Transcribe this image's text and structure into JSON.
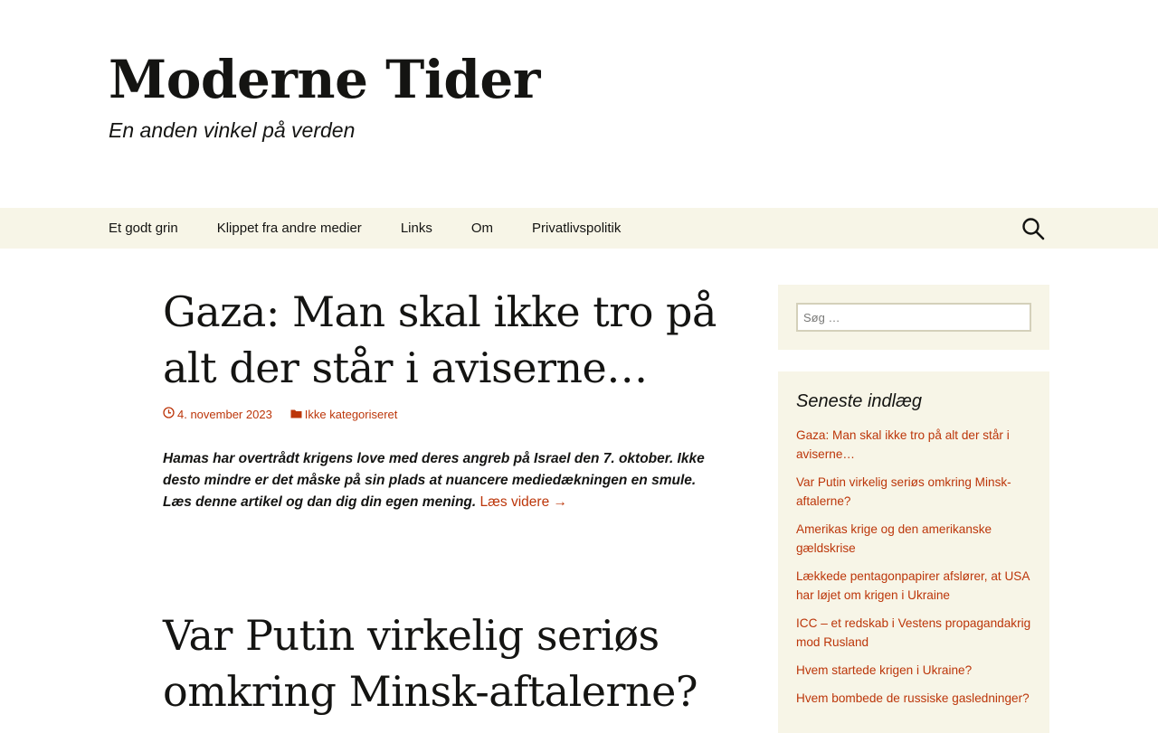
{
  "header": {
    "site_title": "Moderne Tider",
    "tagline": "En anden vinkel på verden"
  },
  "nav": {
    "items": [
      {
        "label": "Et godt grin"
      },
      {
        "label": "Klippet fra andre medier"
      },
      {
        "label": "Links"
      },
      {
        "label": "Om"
      },
      {
        "label": "Privatlivspolitik"
      }
    ],
    "search_icon": "search-icon"
  },
  "posts": [
    {
      "title": "Gaza: Man skal ikke tro på alt der står i aviserne…",
      "date": "4. november 2023",
      "category": "Ikke kategoriseret",
      "excerpt": "Hamas har overtrådt krigens love med deres angreb på Israel den 7. oktober. Ikke desto mindre er det måske på sin plads at nuancere mediedækningen en smule. Læs denne artikel og dan dig din egen mening.",
      "more": "Læs videre →"
    },
    {
      "title": "Var Putin virkelig seriøs omkring Minsk-aftalerne?"
    }
  ],
  "sidebar": {
    "search_placeholder": "Søg …",
    "recent_title": "Seneste indlæg",
    "recent_posts": [
      "Gaza: Man skal ikke tro på alt der står i aviserne…",
      "Var Putin virkelig seriøs omkring Minsk-aftalerne?",
      "Amerikas krige og den amerikanske gældskrise",
      "Lækkede pentagonpapirer afslører, at USA har løjet om krigen i Ukraine",
      "ICC – et redskab i Vestens propagandakrig mod Rusland",
      "Hvem startede krigen i Ukraine?",
      "Hvem bombede de russiske gasledninger?"
    ]
  },
  "colors": {
    "accent": "#bc360a",
    "nav_bg": "#f7f5e7",
    "text": "#141412"
  }
}
